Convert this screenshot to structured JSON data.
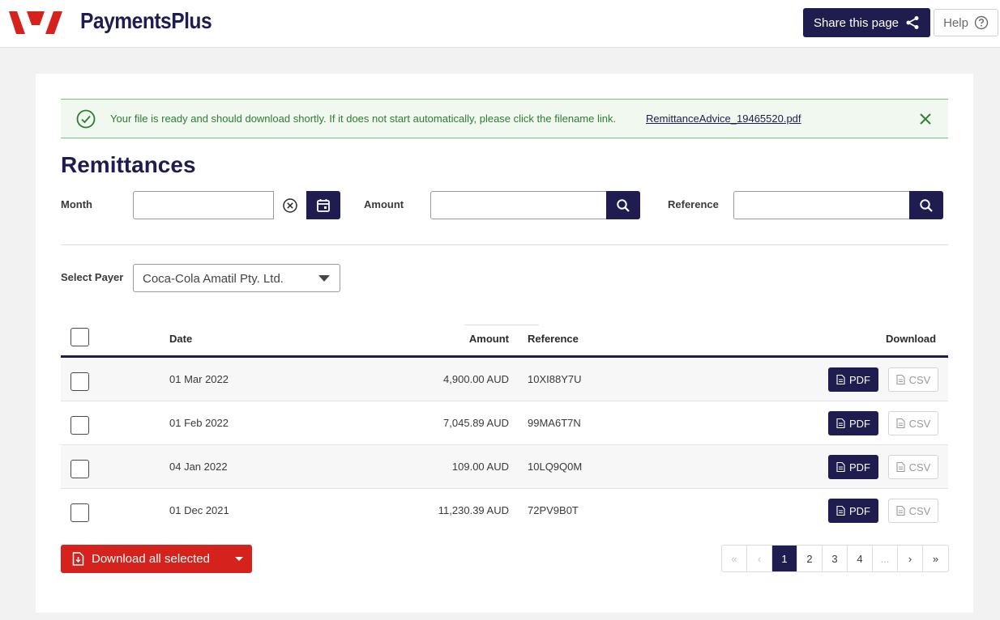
{
  "header": {
    "brand": "PaymentsPlus",
    "share_label": "Share this page",
    "help_label": "Help"
  },
  "alert": {
    "message": "Your file is ready and should download shortly. If it does not start automatically, please click the filename link.",
    "filename": "RemittanceAdvice_19465520.pdf"
  },
  "page_title": "Remittances",
  "filters": {
    "month_label": "Month",
    "month_value": "",
    "amount_label": "Amount",
    "amount_value": "",
    "reference_label": "Reference",
    "reference_value": "",
    "payer_label": "Select Payer",
    "payer_value": "Coca-Cola Amatil Pty. Ltd."
  },
  "table": {
    "columns": {
      "date": "Date",
      "amount": "Amount",
      "reference": "Reference",
      "download": "Download"
    },
    "rows": [
      {
        "date": "01 Mar 2022",
        "amount": "4,900.00 AUD",
        "reference": "10XI88Y7U",
        "pdf": "PDF",
        "csv": "CSV"
      },
      {
        "date": "01 Feb 2022",
        "amount": "7,045.89 AUD",
        "reference": "99MA6T7N",
        "pdf": "PDF",
        "csv": "CSV"
      },
      {
        "date": "04 Jan 2022",
        "amount": "109.00 AUD",
        "reference": "10LQ9Q0M",
        "pdf": "PDF",
        "csv": "CSV"
      },
      {
        "date": "01 Dec 2021",
        "amount": "11,230.39 AUD",
        "reference": "72PV9B0T",
        "pdf": "PDF",
        "csv": "CSV"
      }
    ]
  },
  "download_all_label": "Download all selected",
  "pagination": {
    "first": "«",
    "prev": "‹",
    "pages": [
      "1",
      "2",
      "3",
      "4"
    ],
    "ellipsis": "...",
    "next": "›",
    "last": "»",
    "current": "1"
  },
  "colors": {
    "brand_navy": "#1f1c4f",
    "brand_red": "#d5221c",
    "success_green": "#2e7d32"
  }
}
